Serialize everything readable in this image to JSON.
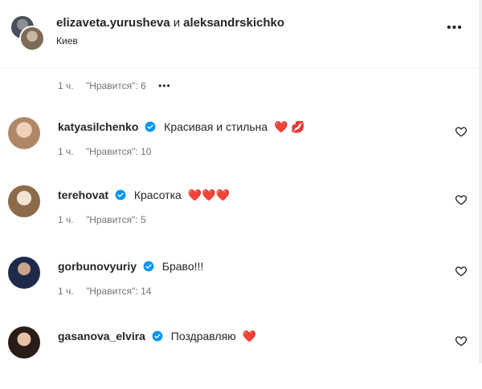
{
  "post": {
    "user_primary": "elizaveta.yurusheva",
    "connector": "и",
    "user_secondary": "aleksandrskichko",
    "location": "Киев",
    "more_label": "•••"
  },
  "caption_meta": {
    "time": "1 ч.",
    "likes": "\"Нравится\": 6",
    "options": "•••"
  },
  "comments": [
    {
      "username": "katyasilchenko",
      "text": "Красивая и стильна",
      "emoji": "❤️ 💋",
      "time": "1 ч.",
      "likes": "\"Нравится\": 10"
    },
    {
      "username": "terehovat",
      "text": "Красотка",
      "emoji": "❤️❤️❤️",
      "time": "1 ч.",
      "likes": "\"Нравится\": 5"
    },
    {
      "username": "gorbunovyuriy",
      "text": "Браво!!!",
      "emoji": "",
      "time": "1 ч.",
      "likes": "\"Нравится\": 14"
    },
    {
      "username": "gasanova_elvira",
      "text": "Поздравляю",
      "emoji": "❤️",
      "time": "",
      "likes": ""
    }
  ],
  "colors": {
    "verified": "#0095f6",
    "heart_red": "#ed4956",
    "secondary_text": "#737373"
  }
}
